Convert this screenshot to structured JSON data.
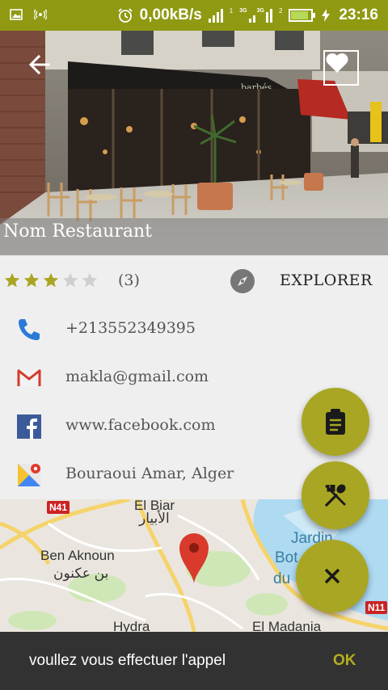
{
  "status_bar": {
    "net_speed": "0,00kB/s",
    "sim1_label": "1",
    "sim2_label": "2",
    "sig_3g_1": "3G",
    "sig_3g_2": "3G",
    "time": "23:16",
    "battery_level": 0.85,
    "icons": [
      "image-icon",
      "hotspot-icon",
      "alarm-icon",
      "signal-icon",
      "battery-icon",
      "charging-icon"
    ]
  },
  "hero": {
    "title": "Nom Restaurant",
    "sign_text": "barbés",
    "icons": [
      "back-arrow-icon",
      "heart-icon"
    ]
  },
  "rating": {
    "stars_filled": 3,
    "stars_total": 5,
    "count": "(3)",
    "explore_label": "EXPLORER"
  },
  "contacts": [
    {
      "icon": "phone-icon",
      "text": "+213552349395"
    },
    {
      "icon": "gmail-icon",
      "text": "makla@gmail.com"
    },
    {
      "icon": "facebook-icon",
      "text": "www.facebook.com"
    },
    {
      "icon": "maps-icon",
      "text": "Bouraoui Amar, Alger"
    }
  ],
  "map": {
    "labels": {
      "el_biar": "El Biar",
      "el_biar_ar": "الأبيار",
      "ben_aknoun": "Ben Aknoun",
      "ben_aknoun_ar": "بن عكنون",
      "hydra": "Hydra",
      "el_madania": "El Madania",
      "jardin": "Jardin",
      "bot": "Bot",
      "du": "du"
    },
    "road_n41": "N41",
    "road_n11": "N11"
  },
  "fabs": [
    "clipboard-icon",
    "cutlery-icon",
    "close-icon"
  ],
  "snackbar": {
    "message": "voullez vous effectuer l'appel",
    "action": "OK"
  },
  "colors": {
    "accent": "#a9a623",
    "status_bar": "#8f9a12",
    "star_on": "#a9a623",
    "star_off": "#cfcfcf",
    "snackbar": "#323232"
  }
}
